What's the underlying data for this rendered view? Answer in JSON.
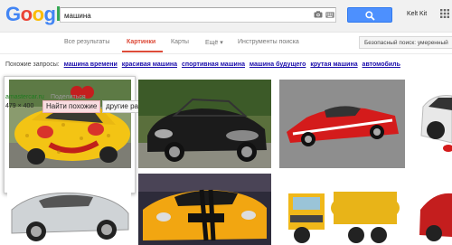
{
  "header": {
    "logo_text": "Google",
    "search_value": "машина",
    "user_name": "Kelt Kit",
    "icons": [
      "camera-icon",
      "keyboard-icon",
      "search-icon",
      "apps-icon"
    ]
  },
  "nav": {
    "items": [
      {
        "label": "Все результаты",
        "active": false
      },
      {
        "label": "Картинки",
        "active": true
      },
      {
        "label": "Карты",
        "active": false
      },
      {
        "label": "Ещё ▾",
        "active": false
      },
      {
        "label": "Инструменты поиска",
        "active": false
      }
    ],
    "safesearch_label": "Безопасный поиск: умеренный"
  },
  "related": {
    "label": "Похожие запросы:",
    "links": [
      "машина времени",
      "красивая машина",
      "спортивная машина",
      "машина будущего",
      "крутая машина",
      "автомобиль"
    ]
  },
  "hover_card": {
    "site": "amastercar.ru",
    "share": "Поделиться",
    "size": "479 × 400",
    "find_similar": "Найти похожие",
    "other_sizes": "другие размеры"
  },
  "colors": {
    "accent": "#dd4b39",
    "link": "#1a0dab",
    "search_button": "#4d90fe",
    "site_green": "#1e7b1e"
  }
}
